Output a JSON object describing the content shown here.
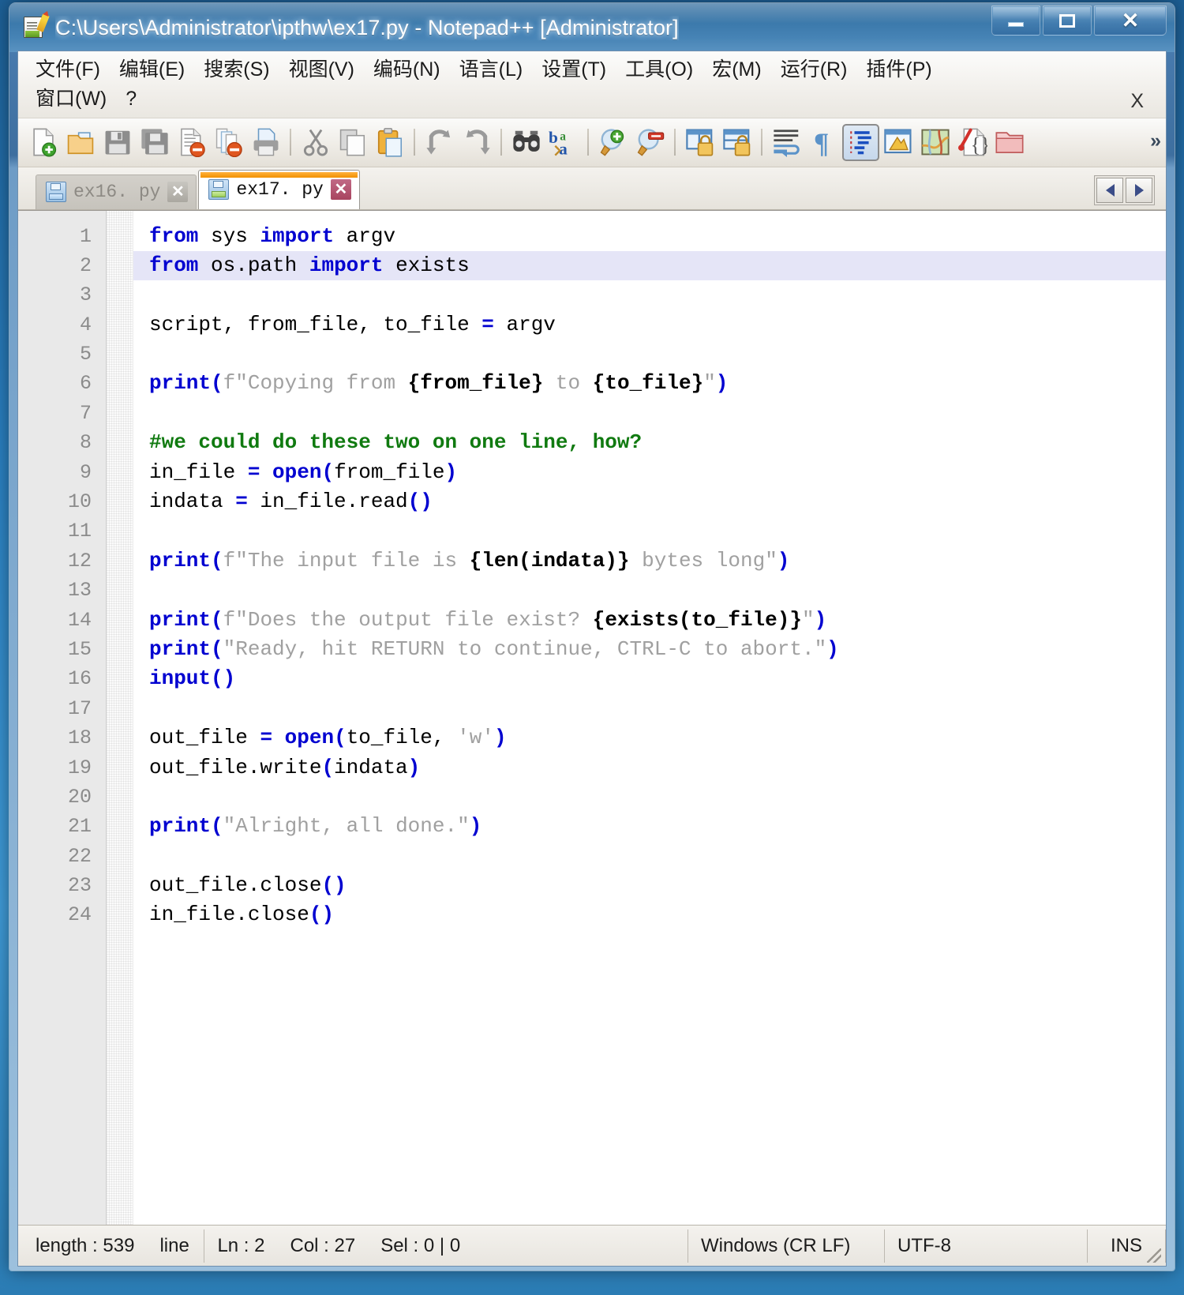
{
  "window": {
    "title": "C:\\Users\\Administrator\\ipthw\\ex17.py - Notepad++ [Administrator]",
    "app_icon": "notepad-plus-plus-icon",
    "buttons": {
      "minimize": "—",
      "maximize": "❐",
      "close": "✕"
    }
  },
  "menubar": {
    "row1": [
      {
        "label": "文件(F)",
        "name": "menu-file"
      },
      {
        "label": "编辑(E)",
        "name": "menu-edit"
      },
      {
        "label": "搜索(S)",
        "name": "menu-search"
      },
      {
        "label": "视图(V)",
        "name": "menu-view"
      },
      {
        "label": "编码(N)",
        "name": "menu-encoding"
      },
      {
        "label": "语言(L)",
        "name": "menu-language"
      },
      {
        "label": "设置(T)",
        "name": "menu-settings"
      },
      {
        "label": "工具(O)",
        "name": "menu-tools"
      },
      {
        "label": "宏(M)",
        "name": "menu-macro"
      },
      {
        "label": "运行(R)",
        "name": "menu-run"
      },
      {
        "label": "插件(P)",
        "name": "menu-plugins"
      }
    ],
    "row2": [
      {
        "label": "窗口(W)",
        "name": "menu-window"
      },
      {
        "label": "?",
        "name": "menu-help"
      }
    ],
    "doc_close": "X"
  },
  "toolbar": {
    "overflow": "»",
    "items": [
      {
        "name": "new-file-icon",
        "title": "New"
      },
      {
        "name": "open-file-icon",
        "title": "Open"
      },
      {
        "name": "save-icon",
        "title": "Save"
      },
      {
        "name": "save-all-icon",
        "title": "Save All"
      },
      {
        "name": "close-file-icon",
        "title": "Close"
      },
      {
        "name": "close-all-icon",
        "title": "Close All"
      },
      {
        "name": "print-icon",
        "title": "Print"
      },
      {
        "name": "separator-1",
        "title": ""
      },
      {
        "name": "cut-icon",
        "title": "Cut"
      },
      {
        "name": "copy-icon",
        "title": "Copy"
      },
      {
        "name": "paste-icon",
        "title": "Paste"
      },
      {
        "name": "separator-2",
        "title": ""
      },
      {
        "name": "undo-icon",
        "title": "Undo"
      },
      {
        "name": "redo-icon",
        "title": "Redo"
      },
      {
        "name": "separator-3",
        "title": ""
      },
      {
        "name": "find-icon",
        "title": "Find"
      },
      {
        "name": "replace-icon",
        "title": "Replace"
      },
      {
        "name": "separator-4",
        "title": ""
      },
      {
        "name": "zoom-in-icon",
        "title": "Zoom In"
      },
      {
        "name": "zoom-out-icon",
        "title": "Zoom Out"
      },
      {
        "name": "separator-5",
        "title": ""
      },
      {
        "name": "sync-vertical-scroll-icon",
        "title": "Sync Vertical Scrolling"
      },
      {
        "name": "sync-horizontal-scroll-icon",
        "title": "Sync Horizontal Scrolling"
      },
      {
        "name": "separator-6",
        "title": ""
      },
      {
        "name": "word-wrap-icon",
        "title": "Word Wrap"
      },
      {
        "name": "show-all-chars-icon",
        "title": "Show All Characters"
      },
      {
        "name": "indent-guide-icon",
        "title": "Indent Guide",
        "pressed": true
      },
      {
        "name": "user-defined-dialog-icon",
        "title": "User Defined Dialogue"
      },
      {
        "name": "document-map-icon",
        "title": "Document Map"
      },
      {
        "name": "function-list-icon",
        "title": "Function List"
      },
      {
        "name": "folder-as-workspace-icon",
        "title": "Folder as Workspace"
      }
    ]
  },
  "tabs": {
    "items": [
      {
        "label": "ex16. py",
        "active": false,
        "name": "tab-ex16-py",
        "close": "✕"
      },
      {
        "label": "ex17. py",
        "active": true,
        "name": "tab-ex17-py",
        "close": "✕"
      }
    ],
    "nav_prev": "◀",
    "nav_next": "▶"
  },
  "editor": {
    "line_numbers": [
      1,
      2,
      3,
      4,
      5,
      6,
      7,
      8,
      9,
      10,
      11,
      12,
      13,
      14,
      15,
      16,
      17,
      18,
      19,
      20,
      21,
      22,
      23,
      24
    ],
    "current_line": 2,
    "lines": [
      {
        "n": 1,
        "text": "from sys import argv"
      },
      {
        "n": 2,
        "text": "from os.path import exists"
      },
      {
        "n": 3,
        "text": ""
      },
      {
        "n": 4,
        "text": "script, from_file, to_file = argv"
      },
      {
        "n": 5,
        "text": ""
      },
      {
        "n": 6,
        "text": "print(f\"Copying from {from_file} to {to_file}\")"
      },
      {
        "n": 7,
        "text": ""
      },
      {
        "n": 8,
        "text": "#we could do these two on one line, how?"
      },
      {
        "n": 9,
        "text": "in_file = open(from_file)"
      },
      {
        "n": 10,
        "text": "indata = in_file.read()"
      },
      {
        "n": 11,
        "text": ""
      },
      {
        "n": 12,
        "text": "print(f\"The input file is {len(indata)} bytes long\")"
      },
      {
        "n": 13,
        "text": ""
      },
      {
        "n": 14,
        "text": "print(f\"Does the output file exist? {exists(to_file)}\")"
      },
      {
        "n": 15,
        "text": "print(\"Ready, hit RETURN to continue, CTRL-C to abort.\")"
      },
      {
        "n": 16,
        "text": "input()"
      },
      {
        "n": 17,
        "text": ""
      },
      {
        "n": 18,
        "text": "out_file = open(to_file, 'w')"
      },
      {
        "n": 19,
        "text": "out_file.write(indata)"
      },
      {
        "n": 20,
        "text": ""
      },
      {
        "n": 21,
        "text": "print(\"Alright, all done.\")"
      },
      {
        "n": 22,
        "text": ""
      },
      {
        "n": 23,
        "text": "out_file.close()"
      },
      {
        "n": 24,
        "text": "in_file.close()"
      }
    ]
  },
  "statusbar": {
    "length": "length : 539",
    "lines": "line",
    "ln": "Ln : 2",
    "col": "Col : 27",
    "sel": "Sel : 0 | 0",
    "eol": "Windows (CR LF)",
    "encoding": "UTF-8",
    "insert_mode": "INS"
  },
  "colors": {
    "keyword": "#0000d0",
    "string": "#a0a0a0",
    "comment": "#107a10",
    "current_line": "#e5e5f7",
    "active_tab_accent": "#f29100",
    "titlebar": "#3b79ab"
  }
}
